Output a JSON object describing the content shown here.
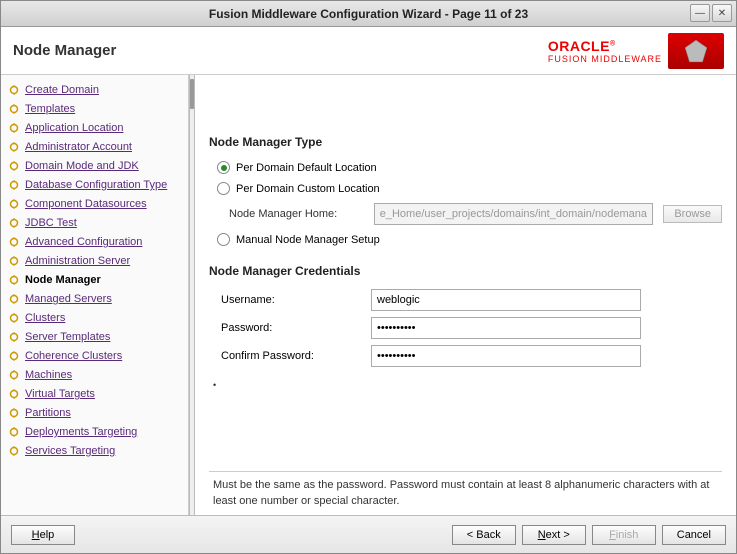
{
  "window": {
    "title": "Fusion Middleware Configuration Wizard - Page 11 of 23"
  },
  "header": {
    "page_title": "Node Manager",
    "brand_top": "ORACLE",
    "brand_sub": "FUSION MIDDLEWARE"
  },
  "sidebar": {
    "items": [
      {
        "label": "Create Domain",
        "active": false
      },
      {
        "label": "Templates",
        "active": false
      },
      {
        "label": "Application Location",
        "active": false
      },
      {
        "label": "Administrator Account",
        "active": false
      },
      {
        "label": "Domain Mode and JDK",
        "active": false
      },
      {
        "label": "Database Configuration Type",
        "active": false
      },
      {
        "label": "Component Datasources",
        "active": false
      },
      {
        "label": "JDBC Test",
        "active": false
      },
      {
        "label": "Advanced Configuration",
        "active": false
      },
      {
        "label": "Administration Server",
        "active": false
      },
      {
        "label": "Node Manager",
        "active": true
      },
      {
        "label": "Managed Servers",
        "active": false
      },
      {
        "label": "Clusters",
        "active": false
      },
      {
        "label": "Server Templates",
        "active": false
      },
      {
        "label": "Coherence Clusters",
        "active": false
      },
      {
        "label": "Machines",
        "active": false
      },
      {
        "label": "Virtual Targets",
        "active": false
      },
      {
        "label": "Partitions",
        "active": false
      },
      {
        "label": "Deployments Targeting",
        "active": false
      },
      {
        "label": "Services Targeting",
        "active": false
      }
    ]
  },
  "content": {
    "type_title": "Node Manager Type",
    "radio1": "Per Domain Default Location",
    "radio2": "Per Domain Custom Location",
    "home_label": "Node Manager Home:",
    "home_value": "e_Home/user_projects/domains/int_domain/nodemanager",
    "browse": "Browse",
    "radio3": "Manual Node Manager Setup",
    "cred_title": "Node Manager Credentials",
    "username_label": "Username:",
    "username_value": "weblogic",
    "password_label": "Password:",
    "password_value": "••••••••••",
    "confirm_label": "Confirm Password:",
    "confirm_value": "••••••••••",
    "hint": "Must be the same as the password. Password must contain at least 8 alphanumeric characters with at least one number or special character."
  },
  "footer": {
    "help": "Help",
    "back": "< Back",
    "next": "Next >",
    "finish": "Finish",
    "cancel": "Cancel"
  }
}
